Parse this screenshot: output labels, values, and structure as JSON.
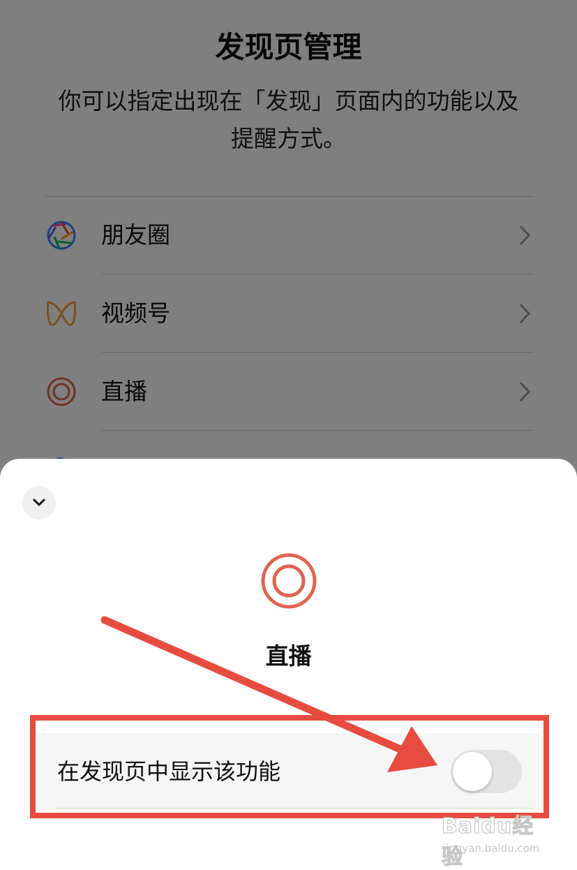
{
  "page": {
    "title": "发现页管理",
    "description": "你可以指定出现在「发现」页面内的功能以及提醒方式。",
    "items": [
      {
        "label": "朋友圈",
        "icon": "moments-aperture-icon"
      },
      {
        "label": "视频号",
        "icon": "channels-butterfly-icon"
      },
      {
        "label": "直播",
        "icon": "live-circle-icon"
      }
    ]
  },
  "sheet": {
    "collapse_icon": "chevron-down-icon",
    "feature_icon": "live-circle-icon",
    "title": "直播",
    "setting_label": "在发现页中显示该功能",
    "toggle_on": false
  },
  "annotation": {
    "highlight_color": "#e84b3f"
  },
  "watermark": {
    "brand": "Baidu经验",
    "url": "jingyan.baidu.com"
  },
  "colors": {
    "overlay": "rgba(0,0,0,0.5)",
    "live_icon": "#e0644f",
    "channels_icon": "#f0a140"
  }
}
